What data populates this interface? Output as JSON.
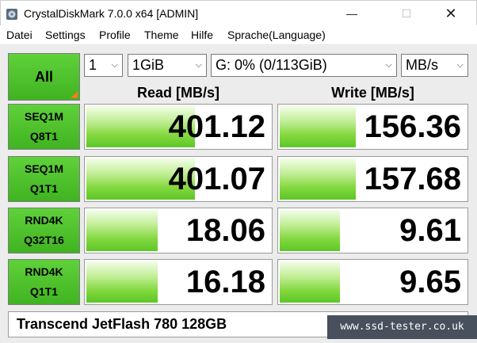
{
  "window": {
    "title": "CrystalDiskMark 7.0.0 x64 [ADMIN]",
    "icon": "disk-app-icon",
    "controls": {
      "minimize": "—",
      "maximize": "☐",
      "close": "✕"
    }
  },
  "menu": [
    "Datei",
    "Settings",
    "Profile",
    "Theme",
    "Hilfe",
    "Sprache(Language)"
  ],
  "toolbar": {
    "all_label": "All",
    "count": "1",
    "size": "1GiB",
    "drive": "G: 0% (0/113GiB)",
    "unit": "MB/s"
  },
  "headers": {
    "read": "Read [MB/s]",
    "write": "Write [MB/s]"
  },
  "tests": [
    {
      "line1": "SEQ1M",
      "line2": "Q8T1",
      "read": "401.12",
      "write": "156.36",
      "read_fill": 0.58,
      "write_fill": 0.4
    },
    {
      "line1": "SEQ1M",
      "line2": "Q1T1",
      "read": "401.07",
      "write": "157.68",
      "read_fill": 0.58,
      "write_fill": 0.4
    },
    {
      "line1": "RND4K",
      "line2": "Q32T16",
      "read": "18.06",
      "write": "9.61",
      "read_fill": 0.38,
      "write_fill": 0.32
    },
    {
      "line1": "RND4K",
      "line2": "Q1T1",
      "read": "16.18",
      "write": "9.65",
      "read_fill": 0.38,
      "write_fill": 0.32
    }
  ],
  "comment": "Transcend JetFlash 780 128GB",
  "watermark": "www.ssd-tester.co.uk",
  "colors": {
    "bar_green": "#5cc727",
    "button_green": "#4bbf2b",
    "corner_orange": "#ff7b18"
  }
}
